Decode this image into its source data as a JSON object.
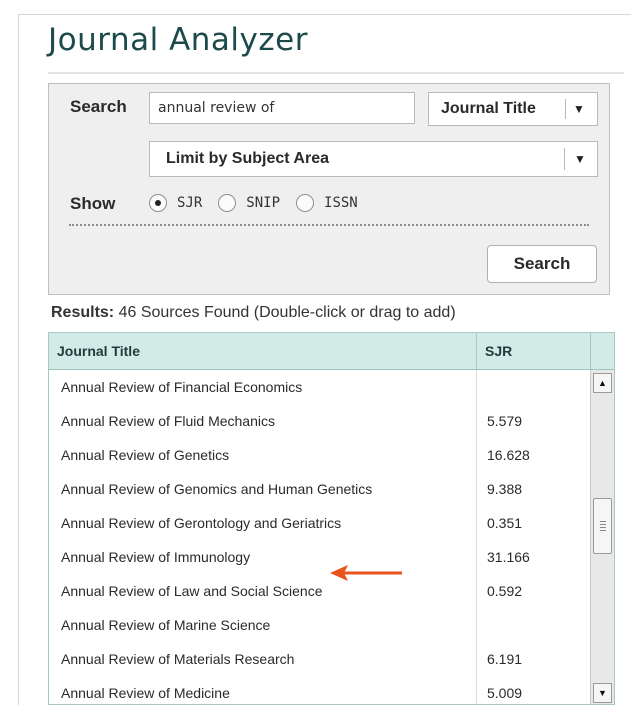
{
  "app_title": "Journal Analyzer",
  "search": {
    "label": "Search",
    "query": "annual review of",
    "field_select": "Journal Title",
    "subject_select": "Limit by Subject Area",
    "button_label": "Search"
  },
  "show": {
    "label": "Show",
    "options": [
      {
        "label": "SJR",
        "selected": true
      },
      {
        "label": "SNIP",
        "selected": false
      },
      {
        "label": "ISSN",
        "selected": false
      }
    ]
  },
  "results": {
    "label": "Results:",
    "summary": "46 Sources Found (Double-click or drag to add)",
    "columns": [
      "Journal Title",
      "SJR"
    ],
    "rows": [
      {
        "title": "Annual Review of Financial Economics",
        "sjr": ""
      },
      {
        "title": "Annual Review of Fluid Mechanics",
        "sjr": "5.579"
      },
      {
        "title": "Annual Review of Genetics",
        "sjr": "16.628"
      },
      {
        "title": "Annual Review of Genomics and Human Genetics",
        "sjr": "9.388"
      },
      {
        "title": "Annual Review of Gerontology and Geriatrics",
        "sjr": "0.351"
      },
      {
        "title": "Annual Review of Immunology",
        "sjr": "31.166"
      },
      {
        "title": "Annual Review of Law and Social Science",
        "sjr": "0.592"
      },
      {
        "title": "Annual Review of Marine Science",
        "sjr": ""
      },
      {
        "title": "Annual Review of Materials Research",
        "sjr": "6.191"
      },
      {
        "title": "Annual Review of Medicine",
        "sjr": "5.009"
      }
    ]
  },
  "scrollbar": {
    "up_icon": "scroll-up-arrow-icon",
    "down_icon": "scroll-down-arrow-icon"
  },
  "annotation": {
    "icon": "left-arrow-icon",
    "color": "#e8531e"
  },
  "colors": {
    "title": "#1d4a4a",
    "table_header": "#d3ebe6",
    "panel": "#efefef"
  }
}
